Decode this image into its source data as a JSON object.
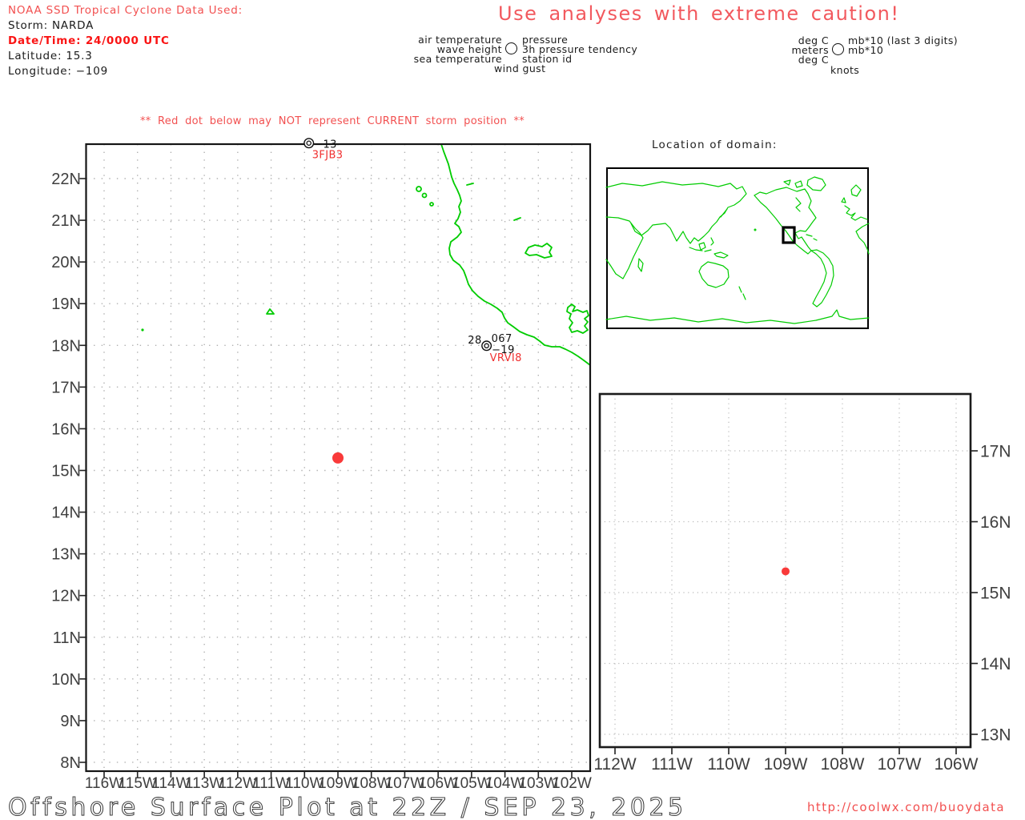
{
  "colors": {
    "header_accent": "#f25050",
    "alert_red": "#fa1414",
    "station_id_red": "#f03030",
    "storm_dot_red": "#f93a3a",
    "coastline_green": "#00cc00",
    "grid_gray": "#b0b0b0",
    "axis_text": "#3f3f3f",
    "text_black": "#1a1a1a"
  },
  "header": {
    "noaa_line": "NOAA SSD Tropical Cyclone Data Used:",
    "storm": "Storm: NARDA",
    "datetime": "Date/Time: 24/0000 UTC",
    "latitude": "Latitude: 15.3",
    "longitude": "Longitude: −109"
  },
  "caution_banner": "Use analyses with extreme caution!",
  "legend": {
    "plot_model": {
      "air_temperature": "air temperature",
      "pressure": "pressure",
      "wave_height": "wave height",
      "pressure_tendency": "3h pressure tendency",
      "sea_temperature": "sea temperature",
      "station_id": "station id",
      "wind_gust": "wind gust"
    },
    "units": {
      "air": "deg C",
      "pressure": "mb*10 (last 3 digits)",
      "wave": "meters",
      "tendency": "mb*10",
      "sea": "deg C",
      "gust": "knots"
    }
  },
  "storm_warning": "** Red dot below may NOT represent CURRENT storm position **",
  "inset": {
    "title": "Location of domain:"
  },
  "footer": {
    "title": "Offshore Surface Plot at 22Z / SEP 23, 2025",
    "url": "http://coolwx.com/buoydata"
  },
  "chart_data": [
    {
      "type": "scatter",
      "name": "main_surface_plot",
      "x_ticks": [
        -116,
        -115,
        -114,
        -113,
        -112,
        -111,
        -110,
        -109,
        -108,
        -107,
        -106,
        -105,
        -104,
        -103,
        -102
      ],
      "x_tick_labels": [
        "116W",
        "115W",
        "114W",
        "113W",
        "112W",
        "111W",
        "110W",
        "109W",
        "108W",
        "107W",
        "106W",
        "105W",
        "104W",
        "103W",
        "102W"
      ],
      "y_ticks": [
        22,
        21,
        20,
        19,
        18,
        17,
        16,
        15,
        14,
        13,
        12,
        11,
        10,
        9,
        8
      ],
      "y_tick_labels": [
        "22N",
        "21N",
        "20N",
        "19N",
        "18N",
        "17N",
        "16N",
        "15N",
        "14N",
        "13N",
        "12N",
        "11N",
        "10N",
        "9N",
        "8N"
      ],
      "xlim": [
        -116.55,
        -101.45
      ],
      "ylim": [
        7.79,
        22.83
      ],
      "grid": "dotted 1-degree",
      "storm_position": {
        "lon": -109,
        "lat": 15.3
      },
      "stations": [
        {
          "id": "3FJB3",
          "lon": -109.87,
          "lat": 22.85,
          "values": {
            "tendency": "−13"
          }
        },
        {
          "id": "VRVI8",
          "lon": -104.55,
          "lat": 17.99,
          "values": {
            "air_temp": "28",
            "pressure": "067",
            "tendency": "−19"
          }
        }
      ]
    },
    {
      "type": "scatter",
      "name": "zoom_domain_plot",
      "x_ticks": [
        -112,
        -111,
        -110,
        -109,
        -108,
        -107,
        -106
      ],
      "x_tick_labels": [
        "112W",
        "111W",
        "110W",
        "109W",
        "108W",
        "107W",
        "106W"
      ],
      "y_ticks": [
        17,
        16,
        15,
        14,
        13
      ],
      "y_tick_labels": [
        "17N",
        "16N",
        "15N",
        "14N",
        "13N"
      ],
      "xlim": [
        -112.27,
        -105.75
      ],
      "ylim": [
        12.8,
        17.8
      ],
      "grid": "dotted 1-degree",
      "storm_position": {
        "lon": -109,
        "lat": 15.3
      }
    },
    {
      "type": "map",
      "name": "world_location_inset",
      "domain_box": {
        "lon_min": -112,
        "lon_max": -106,
        "lat_min": 12.8,
        "lat_max": 17.8
      }
    }
  ]
}
